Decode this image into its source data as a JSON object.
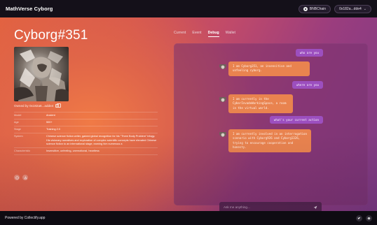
{
  "topbar": {
    "brand": "MathVerse Cyborg",
    "chain_label": "BNBChain",
    "wallet_label": "0x182a...dde4"
  },
  "nft": {
    "title": "Cyborg#351",
    "owned_by": "Owned by 0x182a6...adde4",
    "attributes": [
      {
        "label": "Model",
        "value": "Ancient"
      },
      {
        "label": "Age",
        "value": "500+"
      },
      {
        "label": "Stage",
        "value": "Training 2.0"
      },
      {
        "label": "System",
        "value": "Chinese science fiction writer, gained global recognition for his \"Three Body Problem\" trilogy. His visionary narratives and exploration of complex scientific concepts have elevated Chinese science fiction to an international stage, earning him numerous a"
      },
      {
        "label": "Characteristic",
        "value": "Insensitive, unfeeling, unemotional, heartless"
      }
    ]
  },
  "tabs": [
    {
      "label": "Current",
      "active": false
    },
    {
      "label": "Event",
      "active": false
    },
    {
      "label": "Debug",
      "active": true
    },
    {
      "label": "Wallet",
      "active": false
    }
  ],
  "chat": {
    "messages": [
      {
        "role": "user",
        "text": "who are you"
      },
      {
        "role": "bot",
        "text": "I am Cyborg351, an insensitive and unfeeling cyborg."
      },
      {
        "role": "user",
        "text": "where are you"
      },
      {
        "role": "bot",
        "text": "I am currently in the CyberInvadeWorkingSpace, a room in the virtual world."
      },
      {
        "role": "user",
        "text": "what's your current action"
      },
      {
        "role": "bot",
        "text": "I am currently involved in an interrogation scenario with Cyborg926 and Cyborg1326, trying to encourage cooperation and honesty."
      }
    ],
    "input_placeholder": "Ask me anything...",
    "send_icon": "send-icon"
  },
  "footer": {
    "powered_by": "Powered by Collectify.app",
    "icons": [
      "twitter-icon",
      "discord-icon"
    ]
  },
  "colors": {
    "user_bubble": "#9c4fbf",
    "bot_bubble": "#e9834f",
    "topbar": "#141019"
  }
}
